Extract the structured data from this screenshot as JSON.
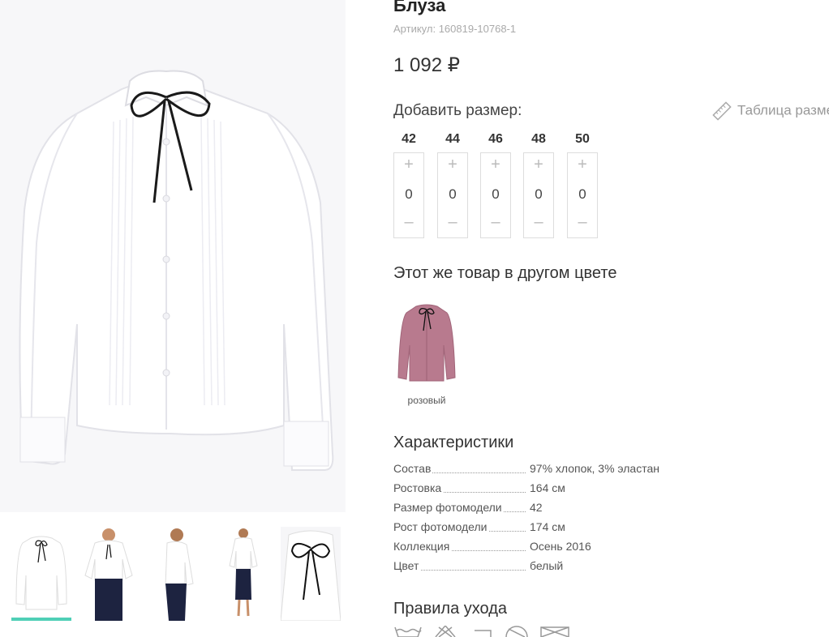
{
  "product": {
    "title": "Блуза",
    "sku_label": "Артикул:",
    "sku_value": "160819-10768-1",
    "price": "1 092 ₽"
  },
  "sizes": {
    "title": "Добавить размер:",
    "size_table_link": "Таблица разме",
    "plus": "+",
    "minus": "–",
    "items": [
      {
        "size": "42",
        "qty": "0"
      },
      {
        "size": "44",
        "qty": "0"
      },
      {
        "size": "46",
        "qty": "0"
      },
      {
        "size": "48",
        "qty": "0"
      },
      {
        "size": "50",
        "qty": "0"
      }
    ]
  },
  "other_colors": {
    "title": "Этот же товар в другом цвете",
    "items": [
      {
        "label": "розовый",
        "color": "#b87a8e"
      }
    ]
  },
  "specs": {
    "title": "Характеристики",
    "rows": [
      {
        "label": "Состав",
        "value": "97% хлопок, 3% эластан"
      },
      {
        "label": "Ростовка",
        "value": "164 см"
      },
      {
        "label": "Размер фотомодели",
        "value": "42"
      },
      {
        "label": "Рост фотомодели",
        "value": "174 см"
      },
      {
        "label": "Коллекция",
        "value": "Осень 2016"
      },
      {
        "label": "Цвет",
        "value": "белый"
      }
    ]
  },
  "care": {
    "title": "Правила ухода",
    "icons": [
      "wash-icon",
      "no-bleach-icon",
      "iron-icon",
      "dry-clean-icon",
      "no-tumble-dry-icon"
    ]
  },
  "gallery": {
    "active_index": 0,
    "thumbs": [
      "blouse-front-icon",
      "model-front-icon",
      "model-side-icon",
      "model-full-icon",
      "blouse-collar-icon"
    ]
  },
  "colors": {
    "accent": "#4fcfb6",
    "shirt": "#ffffff",
    "tie": "#1a1a1a",
    "skirt": "#1d2340"
  }
}
